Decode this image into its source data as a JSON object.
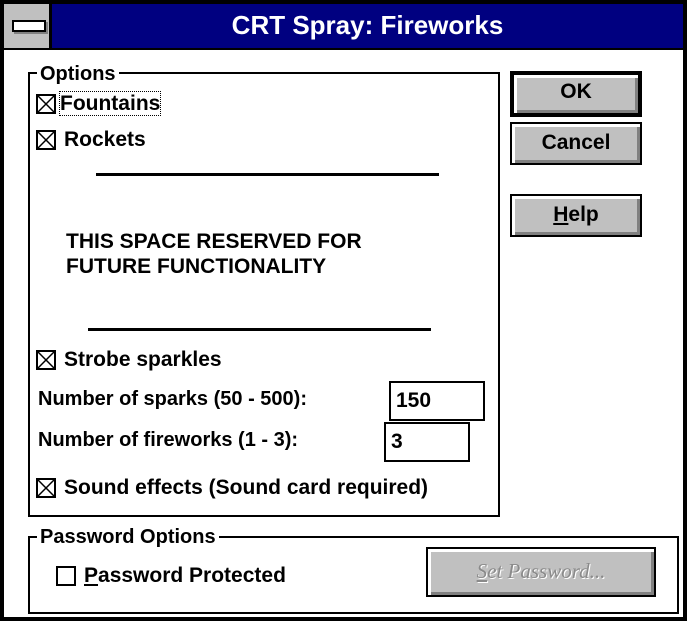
{
  "window": {
    "title": "CRT Spray: Fireworks"
  },
  "options": {
    "group_label": "Options",
    "fountains": {
      "label": "Fountains",
      "checked": true
    },
    "rockets": {
      "label": "Rockets",
      "checked": true
    },
    "reserved_line1": "THIS SPACE RESERVED FOR",
    "reserved_line2": "FUTURE FUNCTIONALITY",
    "strobe": {
      "label": "Strobe sparkles",
      "checked": true
    },
    "sparks": {
      "label": "Number of sparks (50 - 500):",
      "value": "150"
    },
    "fireworks": {
      "label": "Number of fireworks (1 - 3):",
      "value": "3"
    },
    "sound": {
      "label": "Sound effects (Sound card required)",
      "checked": true
    }
  },
  "buttons": {
    "ok": "OK",
    "cancel": "Cancel",
    "help_accel": "H",
    "help_rest": "elp"
  },
  "password": {
    "group_label": "Password Options",
    "protected_accel": "P",
    "protected_rest": "assword Protected",
    "protected_checked": false,
    "set_accel": "S",
    "set_rest": "et Password..."
  }
}
